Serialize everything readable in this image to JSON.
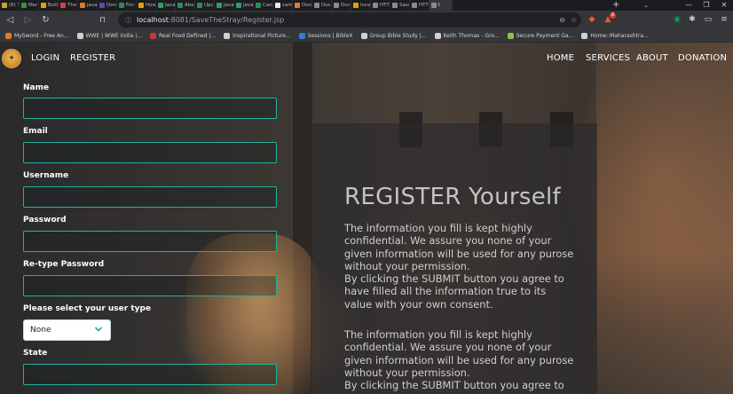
{
  "browser": {
    "tabs": [
      {
        "label": "(6) T",
        "color": "#c9a227"
      },
      {
        "label": "Mer",
        "color": "#3a8f3a"
      },
      {
        "label": "Butt",
        "color": "#e6a100"
      },
      {
        "label": "The",
        "color": "#d93f3f"
      },
      {
        "label": "java",
        "color": "#e07b2a"
      },
      {
        "label": "Don",
        "color": "#5a4bb5"
      },
      {
        "label": "For-",
        "color": "#2e8b57"
      },
      {
        "label": "How",
        "color": "#e6a100"
      },
      {
        "label": "Java",
        "color": "#2e9e5e"
      },
      {
        "label": "Abo",
        "color": "#2e8b57"
      },
      {
        "label": "Upc",
        "color": "#2e8b57"
      },
      {
        "label": "Java",
        "color": "#2e9e5e"
      },
      {
        "label": "Java",
        "color": "#2e9e5e"
      },
      {
        "label": "Can",
        "color": "#2e8b57"
      },
      {
        "label": "sam",
        "color": "#e8e8e8"
      },
      {
        "label": "Don",
        "color": "#e07b2a"
      },
      {
        "label": "Doc",
        "color": "#8a8a8a"
      },
      {
        "label": "Doc",
        "color": "#8a8a8a"
      },
      {
        "label": "local",
        "color": "#e6a100"
      },
      {
        "label": "HTT",
        "color": "#8a8a8a"
      },
      {
        "label": "Save",
        "color": "#8a8a8a"
      },
      {
        "label": "HTT",
        "color": "#8a8a8a"
      },
      {
        "label": "I",
        "color": "#8a8a8a",
        "active": true
      }
    ],
    "new_tab": "+",
    "window_controls": {
      "tabsearch": "⌄",
      "minimize": "—",
      "maximize": "❐",
      "close": "✕"
    },
    "nav": {
      "back": "◁",
      "forward": "▷",
      "reload": "↻",
      "bookmark": "⊓"
    },
    "omnibox": {
      "lock_icon": "ⓘ",
      "host": "localhost",
      "path": ":8081/SaveTheStray/Register.jsp",
      "zoom": "⊖",
      "share": "☆"
    },
    "extensions": {
      "brave": "◆",
      "rewards": "▲",
      "rewards_badge": "8",
      "vpn": "◉",
      "puzzle": "✱",
      "sidebar": "▭",
      "menu": "≡"
    },
    "bookmarks": [
      {
        "label": "MySword - Free An...",
        "color": "#e07b2a"
      },
      {
        "label": "WWE | WWE India |...",
        "color": "#d0d0d0"
      },
      {
        "label": "Real Food Defined |...",
        "color": "#c23b3b"
      },
      {
        "label": "Inspirational Picture...",
        "color": "#d0d0d0"
      },
      {
        "label": "Sessions | BibleX",
        "color": "#3a7bd5"
      },
      {
        "label": "Group Bible Study |...",
        "color": "#d0d0d0"
      },
      {
        "label": "Keith Thomas - Gro...",
        "color": "#d0d0d0"
      },
      {
        "label": "Secure Payment Ga...",
        "color": "#8bc34a"
      },
      {
        "label": "Home::Maharashtra...",
        "color": "#d0d0d0"
      }
    ]
  },
  "navbar": {
    "logo": "✦",
    "left_links": [
      "LOGIN",
      "REGISTER"
    ],
    "right_links": [
      "HOME",
      "SERVICES",
      "ABOUT",
      "DONATION"
    ]
  },
  "form": {
    "fields": [
      {
        "label": "Name",
        "value": ""
      },
      {
        "label": "Email",
        "value": ""
      },
      {
        "label": "Username",
        "value": ""
      },
      {
        "label": "Password",
        "value": ""
      },
      {
        "label": "Re-type Password",
        "value": ""
      }
    ],
    "user_type_label": "Please select your user type",
    "user_type_value": "None",
    "state_label": "State",
    "state_value": ""
  },
  "panel": {
    "title": "REGISTER Yourself",
    "paragraphs": [
      "The information you fill is kept highly confidential. We assure you none of your given information will be used for any purose without your permission.",
      "By clicking the SUBMIT button you agree to have filled all the information true to its value with your own consent.",
      "The information you fill is kept highly confidential. We assure you none of your given information will be used for any purose without your permission.",
      "By clicking the SUBMIT button you agree to"
    ]
  },
  "colors": {
    "input_border": "#1fb39a",
    "accent_brave": "#fb542b"
  }
}
